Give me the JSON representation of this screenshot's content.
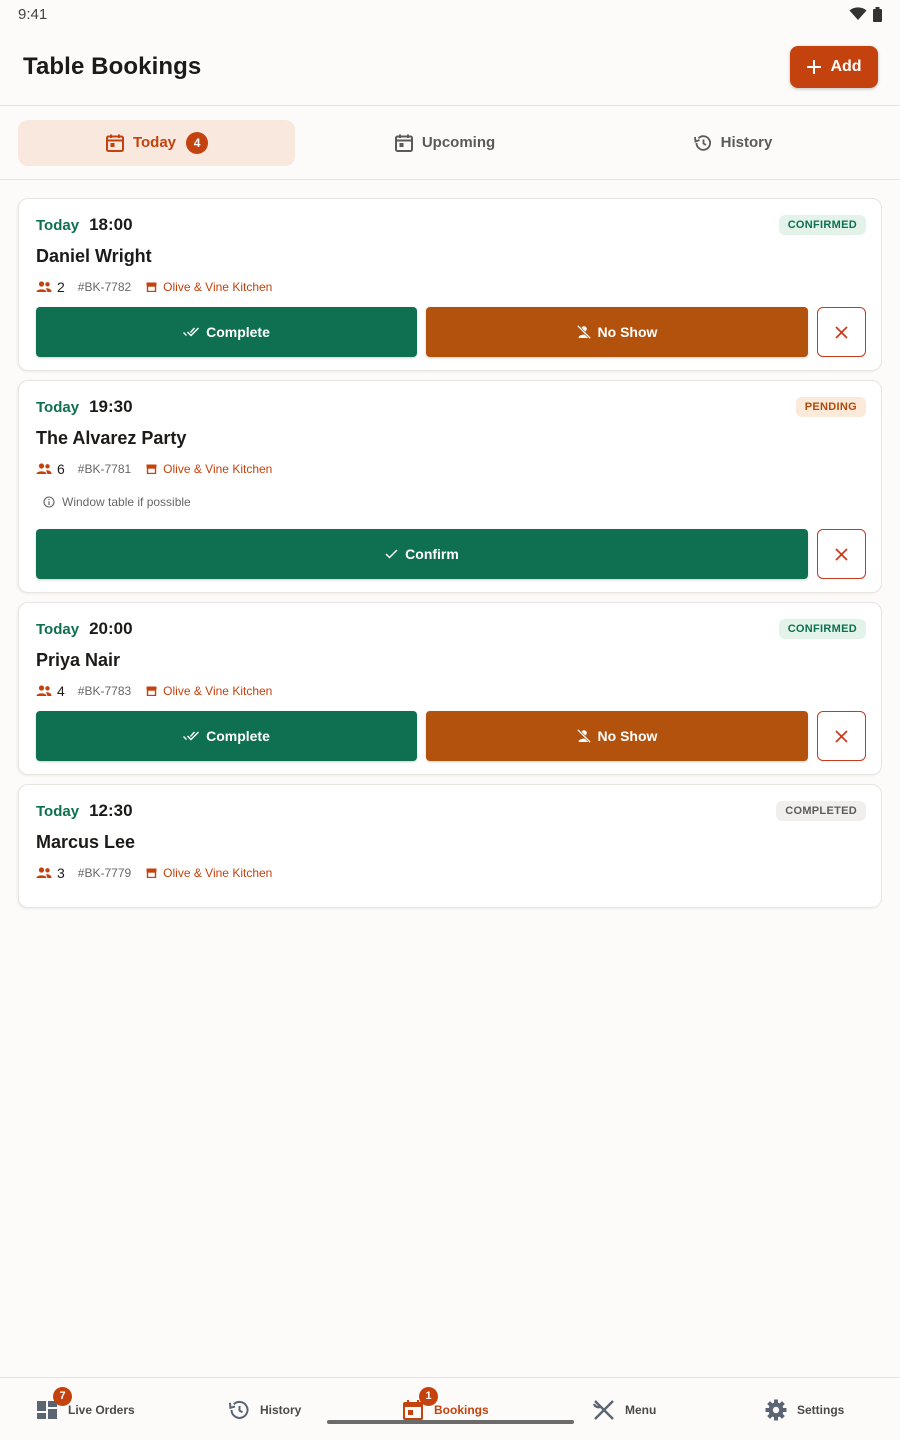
{
  "status_bar": {
    "time": "9:41"
  },
  "header": {
    "title": "Table Bookings",
    "add_label": "Add"
  },
  "tabs": [
    {
      "label": "Today",
      "badge": "4",
      "active": true
    },
    {
      "label": "Upcoming",
      "active": false
    },
    {
      "label": "History",
      "active": false
    }
  ],
  "bookings": [
    {
      "day": "Today",
      "time": "18:00",
      "status": "CONFIRMED",
      "name": "Daniel Wright",
      "party_size": "2",
      "ref": "#BK-7782",
      "restaurant": "Olive & Vine Kitchen",
      "actions": {
        "complete": "Complete",
        "no_show": "No Show"
      }
    },
    {
      "day": "Today",
      "time": "19:30",
      "status": "PENDING",
      "name": "The Alvarez Party",
      "party_size": "6",
      "ref": "#BK-7781",
      "restaurant": "Olive & Vine Kitchen",
      "note": "Window table if possible",
      "actions": {
        "confirm": "Confirm"
      }
    },
    {
      "day": "Today",
      "time": "20:00",
      "status": "CONFIRMED",
      "name": "Priya Nair",
      "party_size": "4",
      "ref": "#BK-7783",
      "restaurant": "Olive & Vine Kitchen",
      "actions": {
        "complete": "Complete",
        "no_show": "No Show"
      }
    },
    {
      "day": "Today",
      "time": "12:30",
      "status": "COMPLETED",
      "name": "Marcus Lee",
      "party_size": "3",
      "ref": "#BK-7779",
      "restaurant": "Olive & Vine Kitchen"
    }
  ],
  "bottom_nav": [
    {
      "label": "Live Orders",
      "icon": "dashboard-icon",
      "badge": "7"
    },
    {
      "label": "History",
      "icon": "history-icon"
    },
    {
      "label": "Bookings",
      "icon": "calendar-icon",
      "badge": "1",
      "active": true
    },
    {
      "label": "Menu",
      "icon": "utensils-icon"
    },
    {
      "label": "Settings",
      "icon": "gear-icon"
    }
  ],
  "colors": {
    "accent": "#c4420d",
    "green": "#0e7050",
    "orange": "#b3520c",
    "background": "#fcfbf9"
  }
}
